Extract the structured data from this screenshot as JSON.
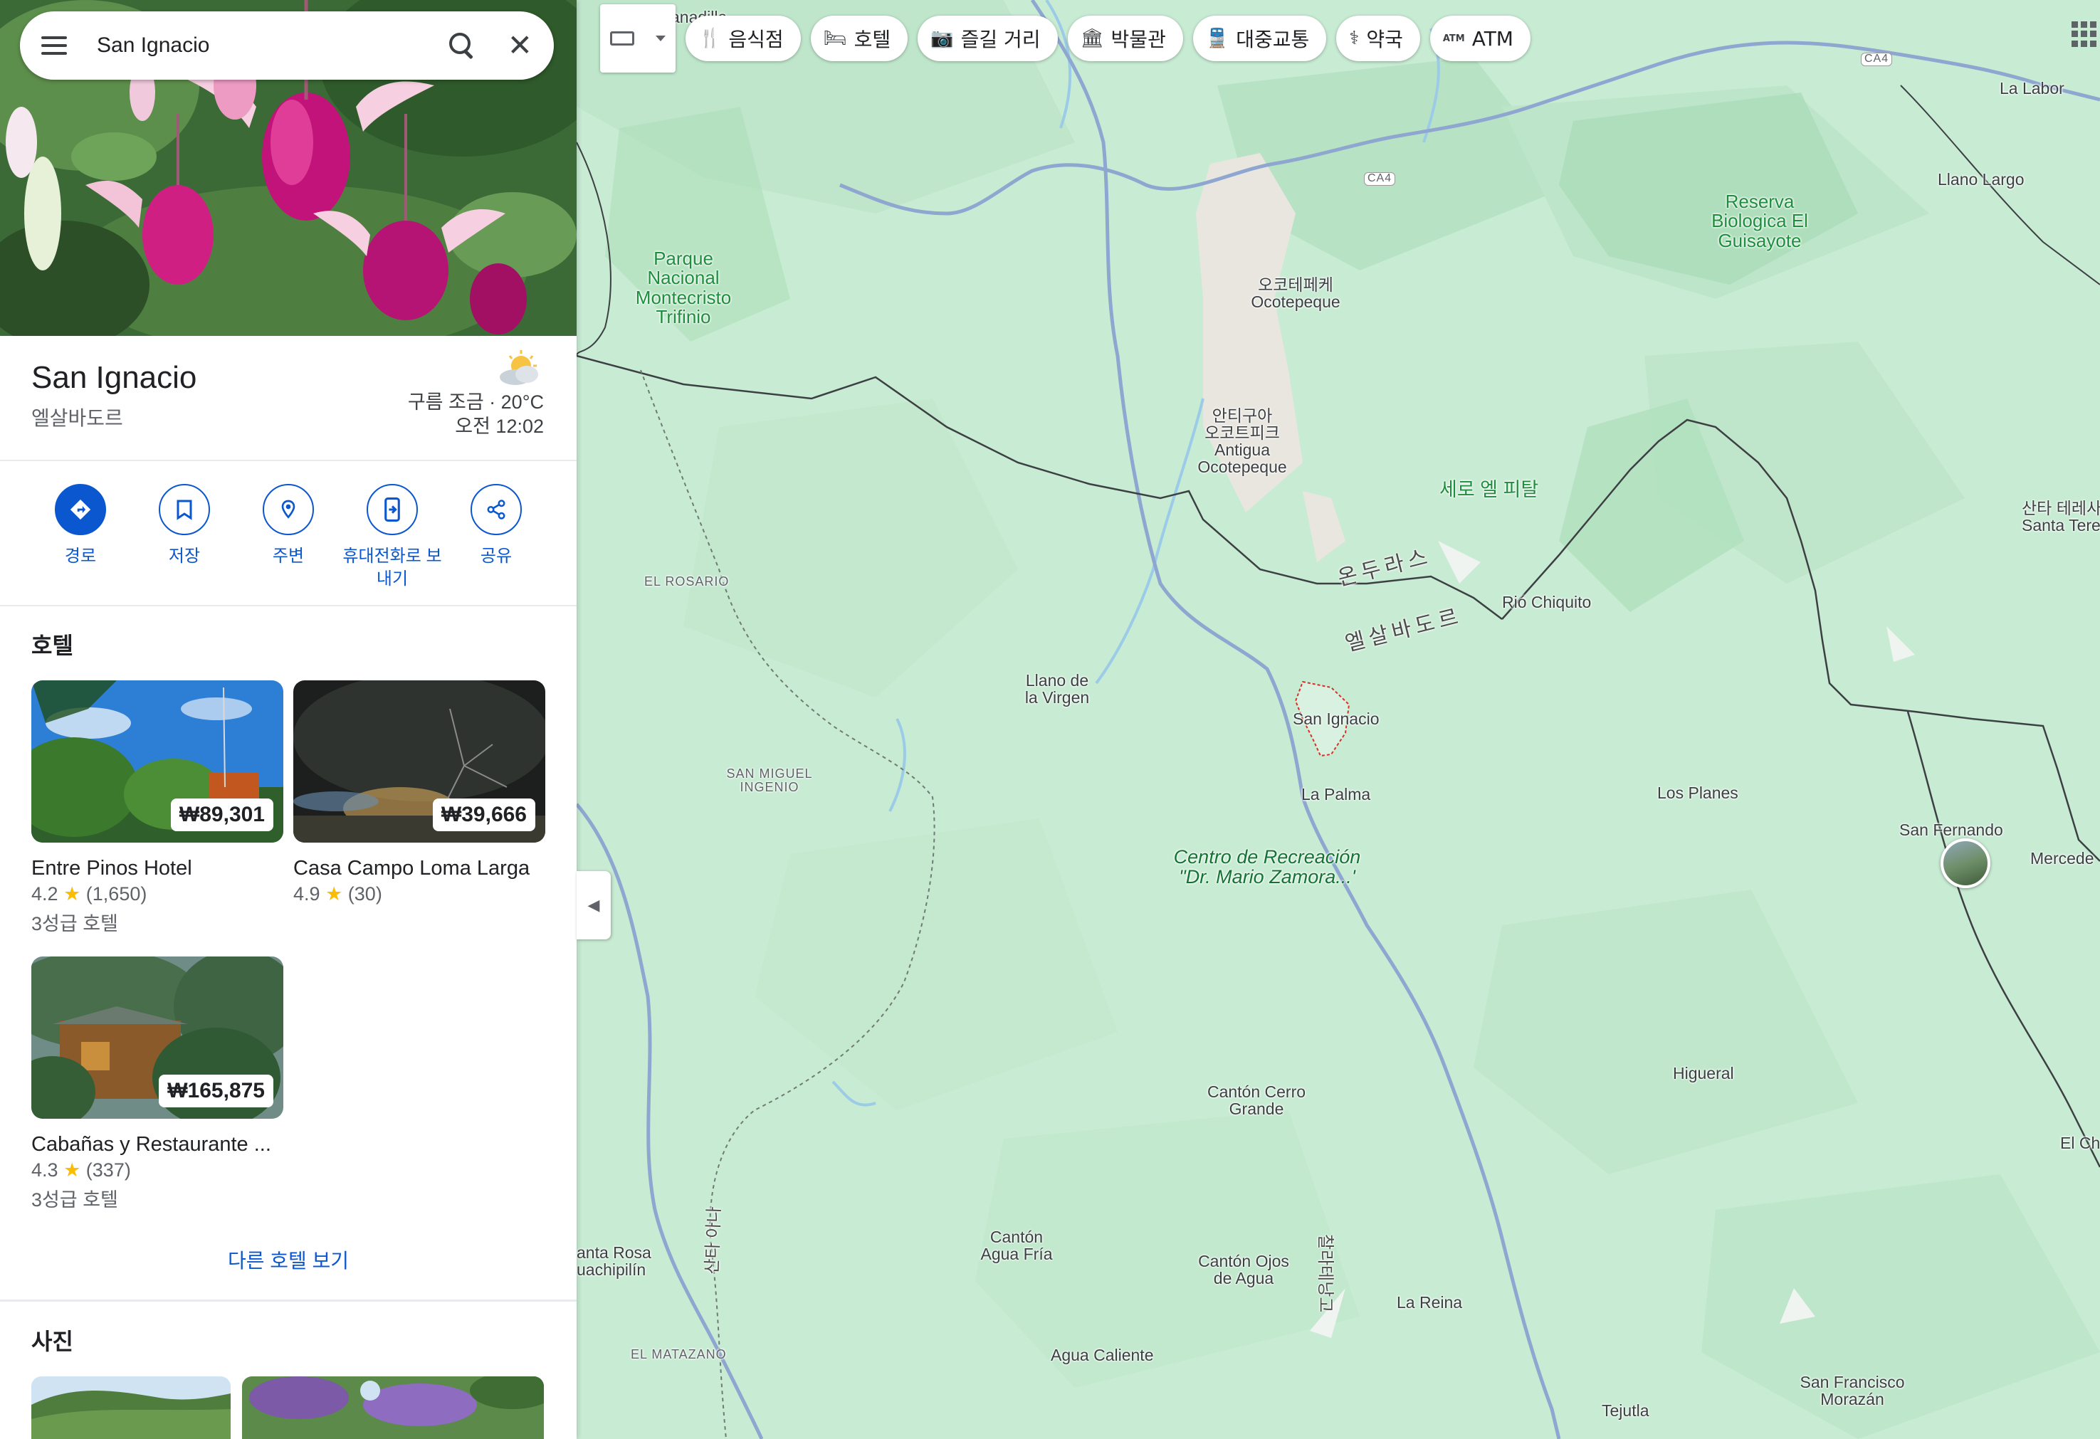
{
  "search": {
    "query": "San Ignacio"
  },
  "place": {
    "name": "San Ignacio",
    "country": "엘살바도르",
    "weather": "구름 조금 · 20°C",
    "time": "오전 12:02"
  },
  "actions": [
    {
      "label": "경로",
      "icon": "directions-icon"
    },
    {
      "label": "저장",
      "icon": "bookmark-icon"
    },
    {
      "label": "주변",
      "icon": "nearby-icon"
    },
    {
      "label_line1": "휴대전화로 보",
      "label_line2": "내기",
      "icon": "send-to-phone-icon"
    },
    {
      "label": "공유",
      "icon": "share-icon"
    }
  ],
  "hotels_section": {
    "title": "호텔",
    "items": [
      {
        "name": "Entre Pinos Hotel",
        "price": "₩89,301",
        "rating": "4.2",
        "reviews": "(1,650)",
        "class": "3성급 호텔"
      },
      {
        "name": "Casa Campo Loma Larga",
        "price": "₩39,666",
        "rating": "4.9",
        "reviews": "(30)",
        "class": ""
      },
      {
        "name": "Cabañas y Restaurante ...",
        "price": "₩165,875",
        "rating": "4.3",
        "reviews": "(337)",
        "class": "3성급 호텔"
      }
    ],
    "more_link": "다른 호텔 보기"
  },
  "photos_section": {
    "title": "사진"
  },
  "chips": [
    {
      "label": "음식점",
      "icon": "restaurant-icon",
      "glyph": "🍴"
    },
    {
      "label": "호텔",
      "icon": "hotel-icon",
      "glyph": "🛏"
    },
    {
      "label": "즐길 거리",
      "icon": "camera-icon",
      "glyph": "📷"
    },
    {
      "label": "박물관",
      "icon": "museum-icon",
      "glyph": "🏛"
    },
    {
      "label": "대중교통",
      "icon": "transit-icon",
      "glyph": "🚆"
    },
    {
      "label": "약국",
      "icon": "pharmacy-icon",
      "glyph": "⚕"
    },
    {
      "label": "ATM",
      "icon": "atm-icon",
      "glyph": "ATM"
    }
  ],
  "map_labels": {
    "anadilla": "anadilla",
    "ca4_top": "CA4",
    "ca4_mid": "CA4",
    "la_labor": "La Labor",
    "llano_largo": "Llano Largo",
    "reserva_1": "Reserva",
    "reserva_2": "Biologica El",
    "reserva_3": "Guisayote",
    "parque_1": "Parque",
    "parque_2": "Nacional",
    "parque_3": "Montecristo",
    "parque_4": "Trifinio",
    "ocotepeque_ko": "오코테페케",
    "ocotepeque": "Ocotepeque",
    "antigua_ko1": "안티구아",
    "antigua_ko2": "오코트피크",
    "antigua_1": "Antigua",
    "antigua_2": "Ocotepeque",
    "cerro_pital": "세로 엘 피탈",
    "santa_teresa_ko": "산타 테레사",
    "santa_teresa": "Santa Teres",
    "el_rosario": "EL ROSARIO",
    "honduras": "온두라스",
    "el_salvador": "엘살바도르",
    "rio_chiquito": "Rió Chiquito",
    "llano_virgen_1": "Llano de",
    "llano_virgen_2": "la Virgen",
    "san_ignacio": "San Ignacio",
    "san_miguel_1": "SAN MIGUEL",
    "san_miguel_2": "INGENIO",
    "la_palma": "La Palma",
    "los_planes": "Los Planes",
    "san_fernando": "San Fernando",
    "mercedes": "Mercede",
    "rec_1": "Centro de Recreación",
    "rec_2": "\"Dr. Mario Zamora...'",
    "higueral": "Higueral",
    "el_ch": "El Ch",
    "canton_cerro_1": "Cantón Cerro",
    "canton_cerro_2": "Grande",
    "santa_rosa_1": "anta Rosa",
    "santa_rosa_2": "uachipilín",
    "road_santa_ana": "산타 아나",
    "road_chalatenango": "찰라테낭고",
    "canton_agua_1": "Cantón",
    "canton_agua_2": "Agua Fría",
    "canton_ojos_1": "Cantón Ojos",
    "canton_ojos_2": "de Agua",
    "la_reina": "La Reina",
    "el_matazano": "EL MATAZANO",
    "agua_caliente": "Agua Caliente",
    "san_francisco_1": "San Francisco",
    "san_francisco_2": "Morazán",
    "tejutla": "Tejutla"
  },
  "colors": {
    "accent": "#0b57d0",
    "map_bg": "#c8ebd3",
    "park_green": "#1e8e3e",
    "star": "#fbbc04"
  }
}
